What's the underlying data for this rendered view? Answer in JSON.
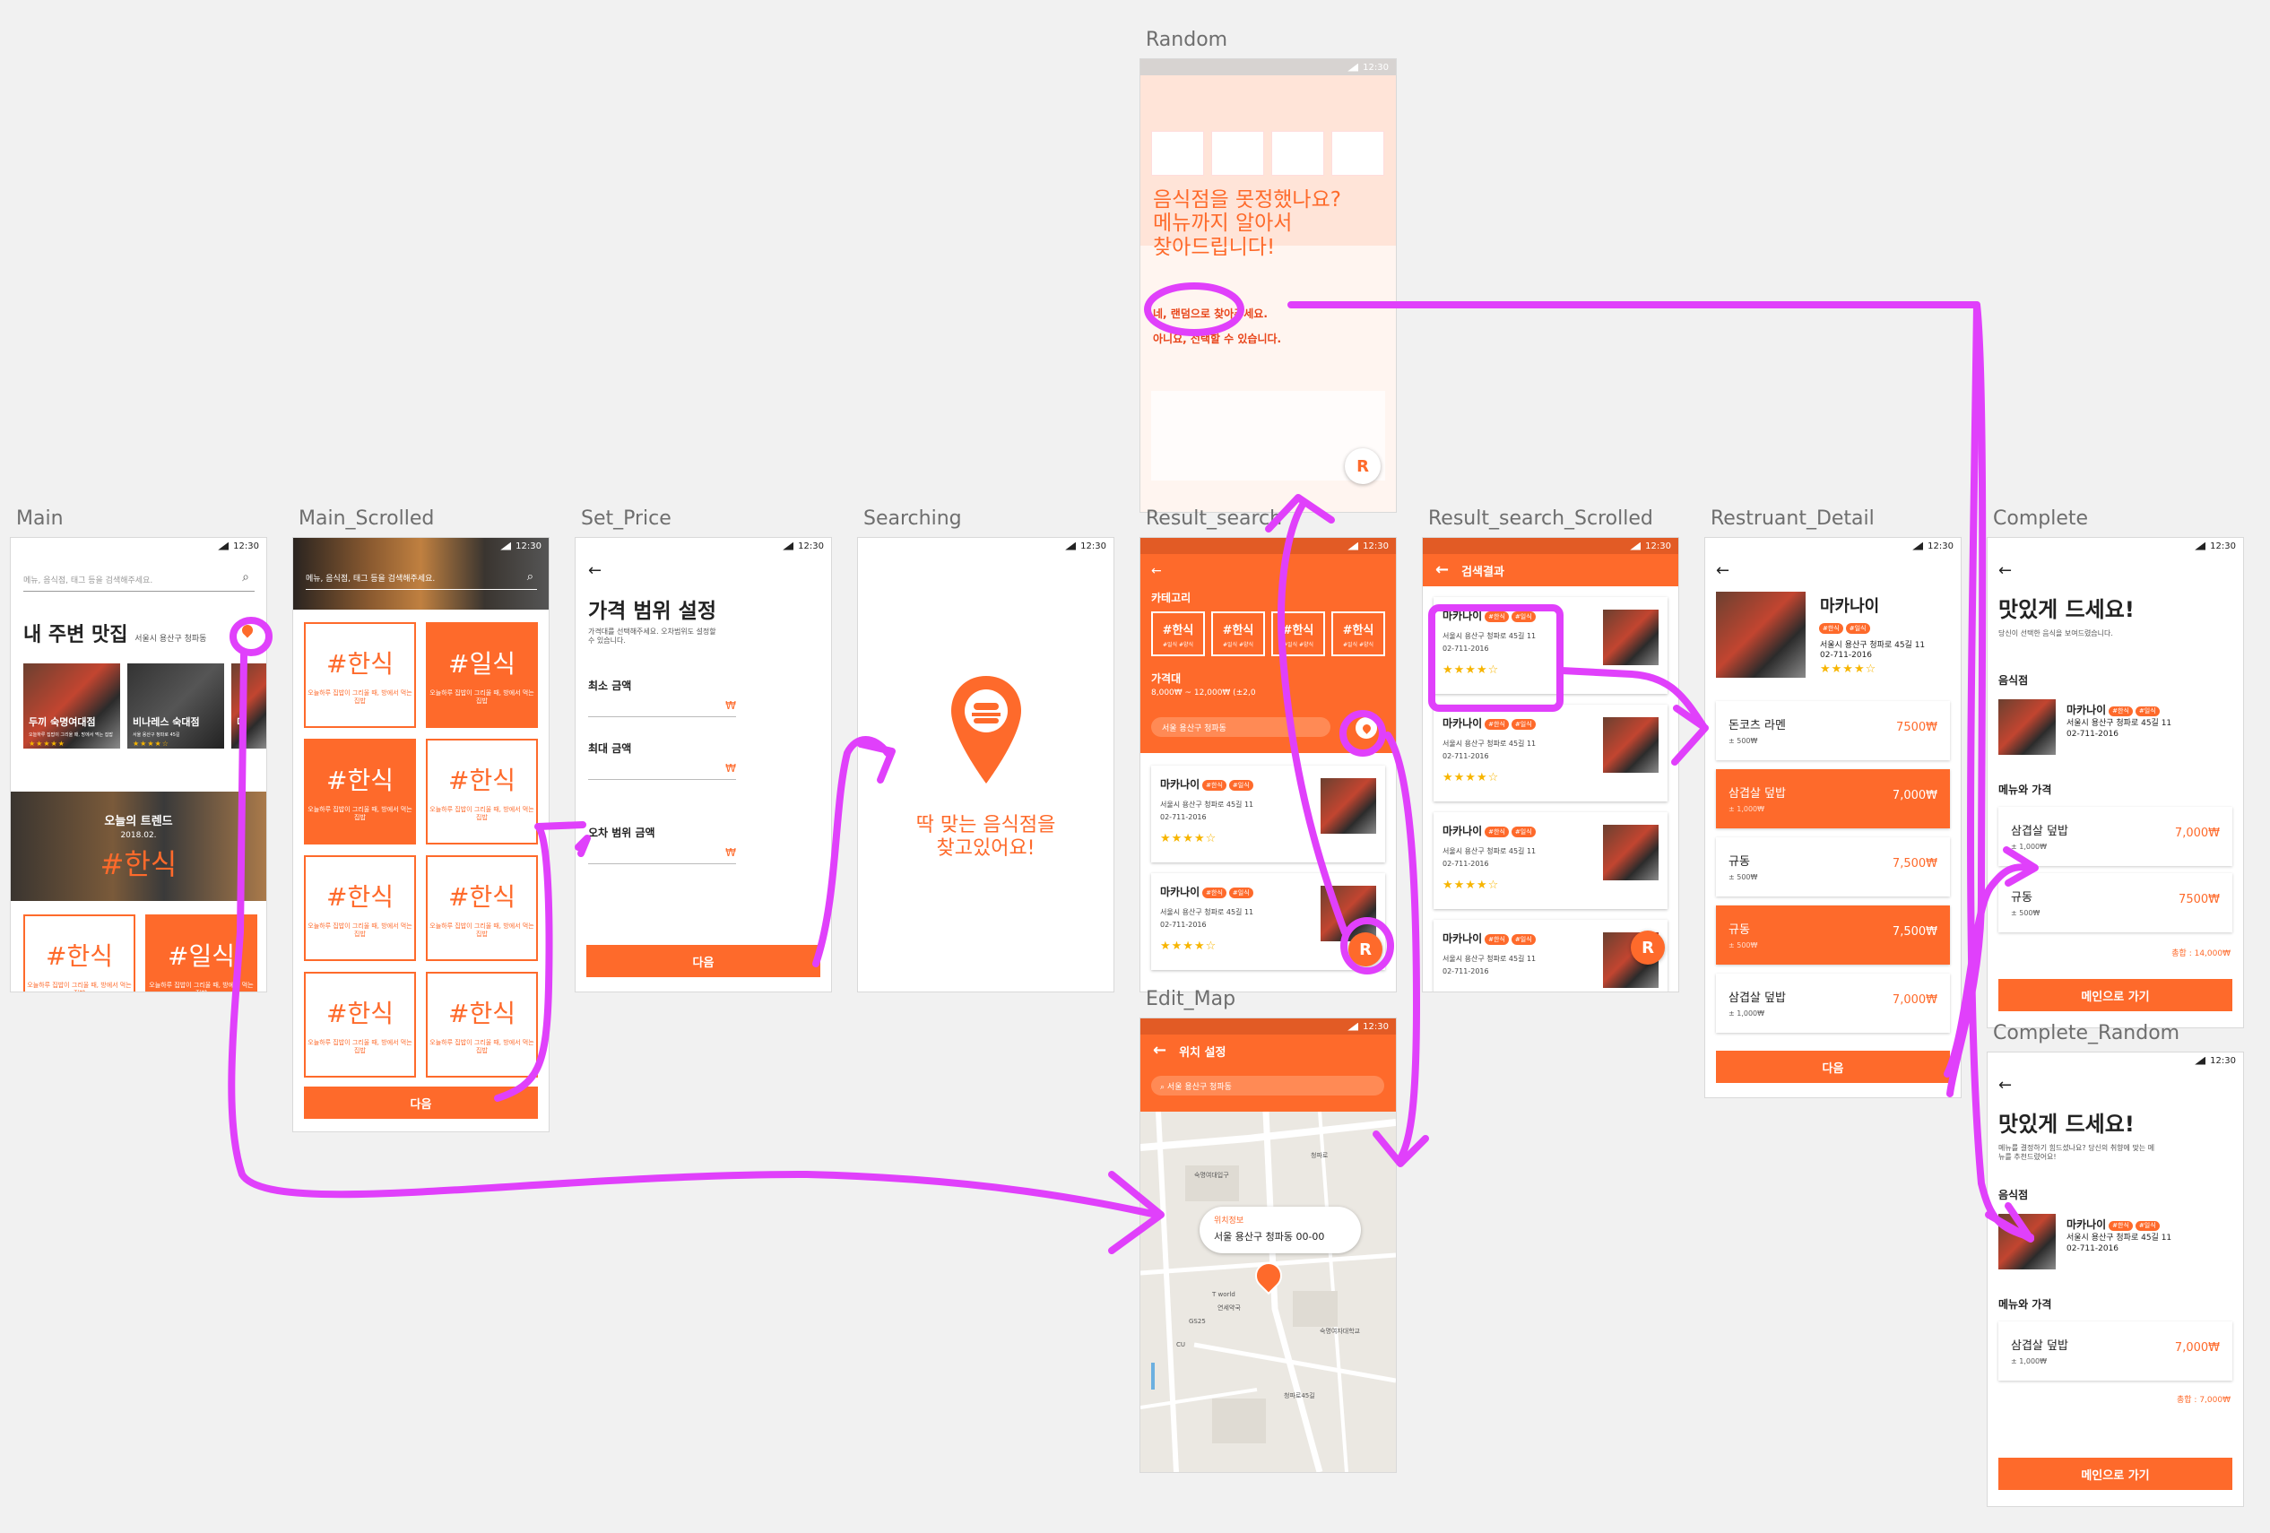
{
  "screens": {
    "main": {
      "label": "Main",
      "time": "12:30",
      "search_placeholder": "메뉴, 음식점, 태그 등을 검색해주세요.",
      "title": "내 주변 맛집",
      "location": "서울시 용산구 청파동",
      "cards": [
        {
          "name": "두끼 숙명여대점",
          "desc": "오늘하루 집밥이 그리울 때, 방에서 먹는 집밥"
        },
        {
          "name": "비나레스 숙대점",
          "desc": "서울 용산구 청파로 45길"
        },
        {
          "name": "미",
          "desc": ""
        }
      ],
      "trend_title": "오늘의 트렌드",
      "trend_date": "2018.02.",
      "trend_tag": "#한식",
      "tiles": [
        {
          "tag": "#한식",
          "desc": "오늘하루 집밥이 그리울 때, 방에서 먹는 집밥"
        },
        {
          "tag": "#일식",
          "desc": "오늘하루 집밥이 그리울 때, 방에서 먹는 집밥"
        }
      ]
    },
    "main_scrolled": {
      "label": "Main_Scrolled",
      "time": "12:30",
      "search_placeholder": "메뉴, 음식점, 태그 등을 검색해주세요.",
      "tiles": [
        {
          "tag": "#한식",
          "desc": "오늘하루 집밥이 그리울 때, 방에서 먹는 집밥",
          "filled": false
        },
        {
          "tag": "#일식",
          "desc": "오늘하루 집밥이 그리울 때, 방에서 먹는 집밥",
          "filled": true
        },
        {
          "tag": "#한식",
          "desc": "오늘하루 집밥이 그리울 때, 방에서 먹는 집밥",
          "filled": true
        },
        {
          "tag": "#한식",
          "desc": "오늘하루 집밥이 그리울 때, 방에서 먹는 집밥",
          "filled": false
        },
        {
          "tag": "#한식",
          "desc": "오늘하루 집밥이 그리울 때, 방에서 먹는 집밥",
          "filled": false
        },
        {
          "tag": "#한식",
          "desc": "오늘하루 집밥이 그리울 때, 방에서 먹는 집밥",
          "filled": false
        },
        {
          "tag": "#한식",
          "desc": "오늘하루 집밥이 그리울 때, 방에서 먹는 집밥",
          "filled": false
        },
        {
          "tag": "#한식",
          "desc": "오늘하루 집밥이 그리울 때, 방에서 먹는 집밥",
          "filled": false
        }
      ],
      "next_button": "다음"
    },
    "set_price": {
      "label": "Set_Price",
      "time": "12:30",
      "title": "가격 범위 설정",
      "desc": "가격대를 선택해주세요. 오차범위도 설정할 수 있습니다.",
      "fields": [
        {
          "label": "최소 금액",
          "unit": "₩"
        },
        {
          "label": "최대 금액",
          "unit": "₩"
        },
        {
          "label": "오차 범위 금액",
          "unit": "₩"
        }
      ],
      "next_button": "다음"
    },
    "searching": {
      "label": "Searching",
      "time": "12:30",
      "message_line1": "딱 맞는 음식점을",
      "message_line2": "찾고있어요!"
    },
    "random": {
      "label": "Random",
      "time": "12:30",
      "question_line1": "음식점을 못정했나요?",
      "question_line2": "메뉴까지 알아서",
      "question_line3": "찾아드립니다!",
      "yes_option": "네, 랜덤으로 찾아주세요.",
      "no_option": "아니요, 선택할 수 있습니다.",
      "fab": "R"
    },
    "result_search": {
      "label": "Result_search",
      "time": "12:30",
      "category_title": "카테고리",
      "categories": [
        {
          "tag": "#한식",
          "sub": "#일식 #양식"
        },
        {
          "tag": "#한식",
          "sub": "#일식 #양식"
        },
        {
          "tag": "#한식",
          "sub": "#일식 #양식"
        },
        {
          "tag": "#한식",
          "sub": "#일식 #양식"
        }
      ],
      "price_title": "가격대",
      "price_range": "8,000₩ ~ 12,000₩ (±2,0",
      "location": "서울 용산구 청파동",
      "results": [
        {
          "name": "마카나이",
          "tags": [
            "#한식",
            "#일식"
          ],
          "address": "서울시 용산구 청파로 45길 11",
          "phone": "02-711-2016",
          "stars": "★★★★☆"
        },
        {
          "name": "마카나이",
          "tags": [
            "#한식",
            "#일식"
          ],
          "address": "서울시 용산구 청파로 45길 11",
          "phone": "02-711-2016",
          "stars": "★★★★☆"
        }
      ],
      "fab": "R"
    },
    "result_search_scrolled": {
      "label": "Result_search_Scrolled",
      "time": "12:30",
      "header": "검색결과",
      "results": [
        {
          "name": "마카나이",
          "tags": [
            "#한식",
            "#일식"
          ],
          "address": "서울시 용산구 청파로 45길 11",
          "phone": "02-711-2016",
          "stars": "★★★★☆"
        },
        {
          "name": "마카나이",
          "tags": [
            "#한식",
            "#일식"
          ],
          "address": "서울시 용산구 청파로 45길 11",
          "phone": "02-711-2016",
          "stars": "★★★★☆"
        },
        {
          "name": "마카나이",
          "tags": [
            "#한식",
            "#일식"
          ],
          "address": "서울시 용산구 청파로 45길 11",
          "phone": "02-711-2016",
          "stars": "★★★★☆"
        },
        {
          "name": "마카나이",
          "tags": [
            "#한식",
            "#일식"
          ],
          "address": "서울시 용산구 청파로 45길 11",
          "phone": "02-711-2016",
          "stars": ""
        }
      ],
      "fab": "R"
    },
    "edit_map": {
      "label": "Edit_Map",
      "time": "12:30",
      "header": "위치 설정",
      "search_value": "서울 용산구 청파동",
      "info_title": "위치정보",
      "info_address": "서울 용산구 청파동 00-00",
      "map_labels": [
        "숙명여대입구",
        "청파로",
        "T world",
        "GS25",
        "CU",
        "연세약국",
        "숙명여자대학교",
        "청파로45길"
      ]
    },
    "restaurant_detail": {
      "label": "Restruant_Detail",
      "time": "12:30",
      "name": "마카나이",
      "tags": [
        "#한식",
        "#일식"
      ],
      "address": "서울시 용산구 청파로 45길 11",
      "phone": "02-711-2016",
      "stars": "★★★★☆",
      "menus": [
        {
          "name": "돈코츠 라멘",
          "sub": "± 500₩",
          "price": "7500₩",
          "selected": false
        },
        {
          "name": "삼겹살 덮밥",
          "sub": "± 1,000₩",
          "price": "7,000₩",
          "selected": true
        },
        {
          "name": "규동",
          "sub": "± 500₩",
          "price": "7,500₩",
          "selected": false
        },
        {
          "name": "규동",
          "sub": "± 500₩",
          "price": "7,500₩",
          "selected": true
        },
        {
          "name": "삼겹살 덮밥",
          "sub": "± 1,000₩",
          "price": "7,000₩",
          "selected": false
        }
      ],
      "next_button": "다음"
    },
    "complete": {
      "label": "Complete",
      "time": "12:30",
      "title": "맛있게 드세요!",
      "desc": "당신이 선택한 음식을 보여드렸습니다.",
      "restaurant_section": "음식점",
      "restaurant": {
        "name": "마카나이",
        "tags": [
          "#한식",
          "#일식"
        ],
        "address": "서울시 용산구 청파로 45길 11",
        "phone": "02-711-2016"
      },
      "menu_section": "메뉴와 가격",
      "menus": [
        {
          "name": "삼겹살 덮밥",
          "sub": "± 1,000₩",
          "price": "7,000₩"
        },
        {
          "name": "규동",
          "sub": "± 500₩",
          "price": "7500₩"
        }
      ],
      "total": "총합 : 14,000₩",
      "home_button": "메인으로 가기"
    },
    "complete_random": {
      "label": "Complete_Random",
      "time": "12:30",
      "title": "맛있게 드세요!",
      "desc": "메뉴를 결정하기 힘드셨나요? 당신의 취향에 맞는 메뉴를 추천드렸어요!",
      "restaurant_section": "음식점",
      "restaurant": {
        "name": "마카나이",
        "tags": [
          "#한식",
          "#일식"
        ],
        "address": "서울시 용산구 청파로 45길 11",
        "phone": "02-711-2016"
      },
      "menu_section": "메뉴와 가격",
      "menus": [
        {
          "name": "삼겹살 덮밥",
          "sub": "± 1,000₩",
          "price": "7,000₩"
        }
      ],
      "total": "총합 : 7,000₩",
      "home_button": "메인으로 가기"
    }
  },
  "colors": {
    "accent": "#fe6a2b",
    "annotation": "#e040fb",
    "canvas": "#f1f1f1"
  }
}
